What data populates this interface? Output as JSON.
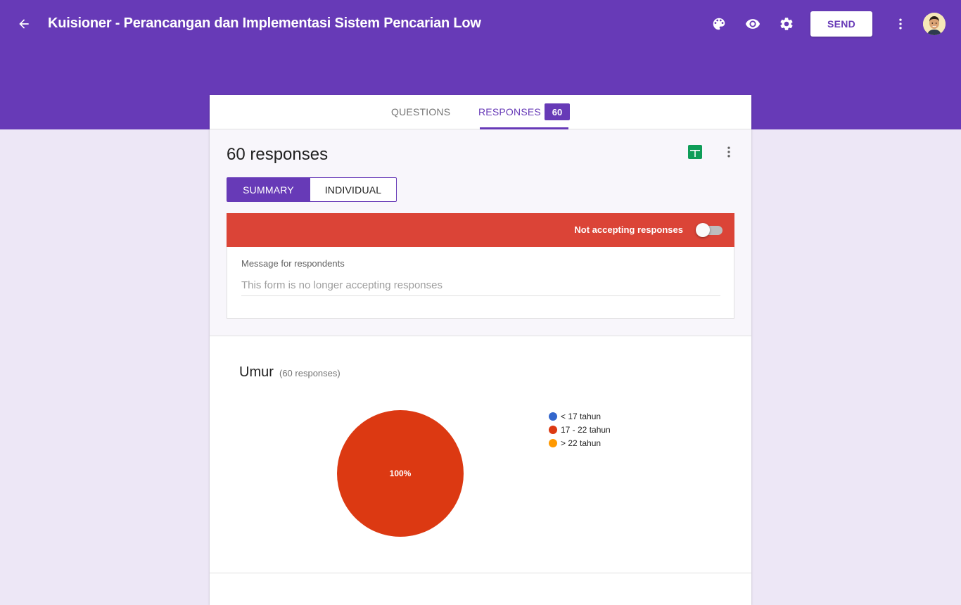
{
  "header": {
    "title": "Kuisioner - Perancangan dan Implementasi Sistem Pencarian Low",
    "send_label": "SEND",
    "icons": [
      "back-arrow-icon",
      "palette-icon",
      "eye-icon",
      "gear-icon",
      "more-vert-icon"
    ],
    "bg_color": "#673ab7"
  },
  "tabs": {
    "questions_label": "QUESTIONS",
    "responses_label": "RESPONSES",
    "responses_count": "60"
  },
  "responses": {
    "title": "60 responses",
    "summary_label": "SUMMARY",
    "individual_label": "INDIVIDUAL",
    "accepting_label": "Not accepting responses",
    "accepting": false,
    "accepting_bar_color": "#db4437",
    "message_label": "Message for respondents",
    "message_placeholder": "This form is no longer accepting responses",
    "message_value": ""
  },
  "question": {
    "title": "Umur",
    "count_label": "(60 responses)"
  },
  "chart_data": {
    "type": "pie",
    "categories": [
      "< 17 tahun",
      "17 - 22 tahun",
      "> 22 tahun"
    ],
    "values": [
      0,
      100,
      0
    ],
    "colors": [
      "#3366cc",
      "#dc3912",
      "#ff9900"
    ],
    "slice_labels": [
      "",
      "100%",
      ""
    ],
    "legend_position": "right"
  }
}
